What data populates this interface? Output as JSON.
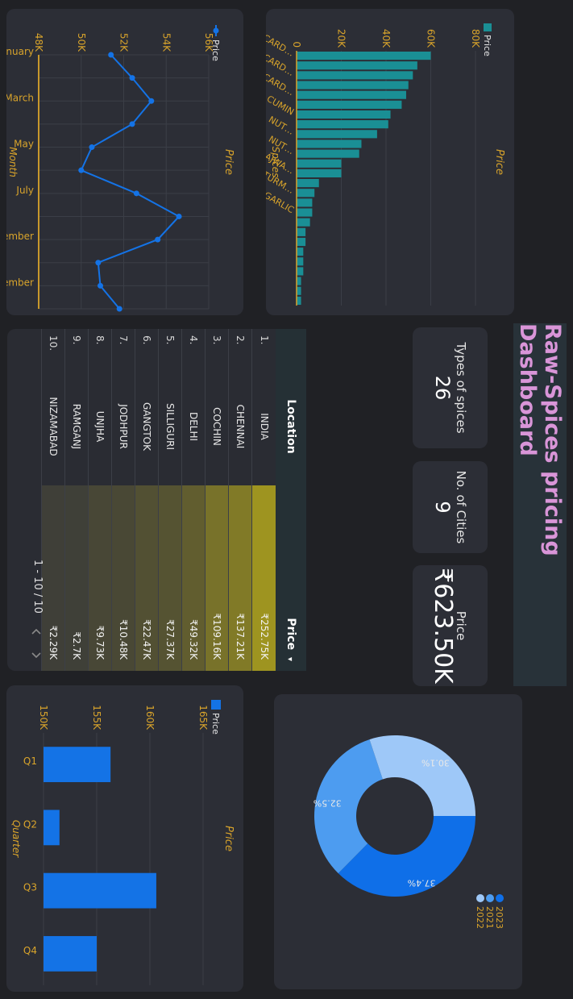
{
  "title": "Raw-Spices pricing Dashboard",
  "kpis": {
    "types_label": "Types of spices",
    "types_value": "26",
    "cities_label": "No. of Cities",
    "cities_value": "9",
    "price_label": "Price",
    "price_value": "₹623.50K"
  },
  "location_table": {
    "headers": [
      "Location",
      "Price"
    ],
    "sort_indicator": "▾",
    "rows": [
      {
        "rank": "1.",
        "location": "INDIA",
        "price": "₹252.75K",
        "value": 252.75
      },
      {
        "rank": "2.",
        "location": "CHENNAI",
        "price": "₹137.21K",
        "value": 137.21
      },
      {
        "rank": "3.",
        "location": "COCHIN",
        "price": "₹109.16K",
        "value": 109.16
      },
      {
        "rank": "4.",
        "location": "DELHI",
        "price": "₹49.32K",
        "value": 49.32
      },
      {
        "rank": "5.",
        "location": "SILLIGURI",
        "price": "₹27.37K",
        "value": 27.37
      },
      {
        "rank": "6.",
        "location": "GANGTOK",
        "price": "₹22.47K",
        "value": 22.47
      },
      {
        "rank": "7.",
        "location": "JODHPUR",
        "price": "₹10.48K",
        "value": 10.48
      },
      {
        "rank": "8.",
        "location": "UNJHA",
        "price": "₹9.73K",
        "value": 9.73
      },
      {
        "rank": "9.",
        "location": "RAMGANJ",
        "price": "₹2.7K",
        "value": 2.7
      },
      {
        "rank": "10.",
        "location": "NIZAMABAD",
        "price": "₹2.29K",
        "value": 2.29
      }
    ],
    "pagination": "1 - 10 / 10",
    "prev_icon": "chevron-left",
    "next_icon": "chevron-right"
  },
  "colors": {
    "accent": "#d9a42b",
    "teal_bar": "#1a8f95",
    "blue": "#1473e6",
    "table_highlight": "#9e9420"
  },
  "chart_data": [
    {
      "id": "spices",
      "type": "bar",
      "title": "Price",
      "xlabel": "Spices",
      "ylabel": "",
      "series": [
        {
          "name": "Price",
          "color": "#1a8f95"
        }
      ],
      "categories": [
        "CARD…",
        "",
        "CARD…",
        "",
        "CARD…",
        "",
        "CUMIN",
        "",
        "NUT…",
        "",
        "NUT…",
        "",
        "AJWA…",
        "",
        "TURM…",
        "",
        "GARLIC",
        "",
        "",
        "",
        "",
        "",
        "",
        "",
        "",
        ""
      ],
      "values": [
        60,
        54,
        52,
        50,
        49,
        47,
        42,
        41,
        36,
        29,
        28,
        20,
        20,
        10,
        8,
        7,
        7,
        6,
        4,
        4,
        3,
        3,
        3,
        2,
        2,
        2
      ],
      "yticks": [
        "0",
        "20K",
        "40K",
        "60K",
        "80K"
      ],
      "ylim": [
        0,
        80
      ]
    },
    {
      "id": "monthly",
      "type": "line",
      "title": "Price",
      "xlabel": "Month",
      "ylabel": "",
      "series": [
        {
          "name": "Price",
          "color": "#1473e6"
        }
      ],
      "x": [
        "January",
        "February",
        "March",
        "April",
        "May",
        "June",
        "July",
        "August",
        "September",
        "October",
        "November",
        "December"
      ],
      "xticks": [
        "January",
        "March",
        "May",
        "July",
        "September",
        "November"
      ],
      "values": [
        51.4,
        52.4,
        53.3,
        52.4,
        50.5,
        50,
        52.6,
        54.6,
        53.6,
        50.8,
        50.9,
        51.8
      ],
      "yticks": [
        "48K",
        "50K",
        "52K",
        "54K",
        "56K"
      ],
      "ylim": [
        48,
        56
      ],
      "reference_y": 48
    },
    {
      "id": "quarters",
      "type": "bar",
      "title": "Price",
      "xlabel": "Quarter",
      "ylabel": "",
      "series": [
        {
          "name": "Price",
          "color": "#1473e6"
        }
      ],
      "categories": [
        "Q1",
        "Q2",
        "Q3",
        "Q4"
      ],
      "values": [
        156.3,
        151.5,
        160.6,
        155
      ],
      "yticks": [
        "150K",
        "155K",
        "160K",
        "165K"
      ],
      "ylim": [
        150,
        165
      ]
    },
    {
      "id": "years",
      "type": "pie",
      "categories": [
        "2023",
        "2021",
        "2022"
      ],
      "values": [
        37.4,
        32.5,
        30.1
      ],
      "labels": [
        "37.4%",
        "32.5%",
        "30.1%"
      ],
      "colors": [
        "#0f6fe8",
        "#4d9cf0",
        "#9ec8f8"
      ],
      "legend_position": "bottom-left"
    }
  ]
}
